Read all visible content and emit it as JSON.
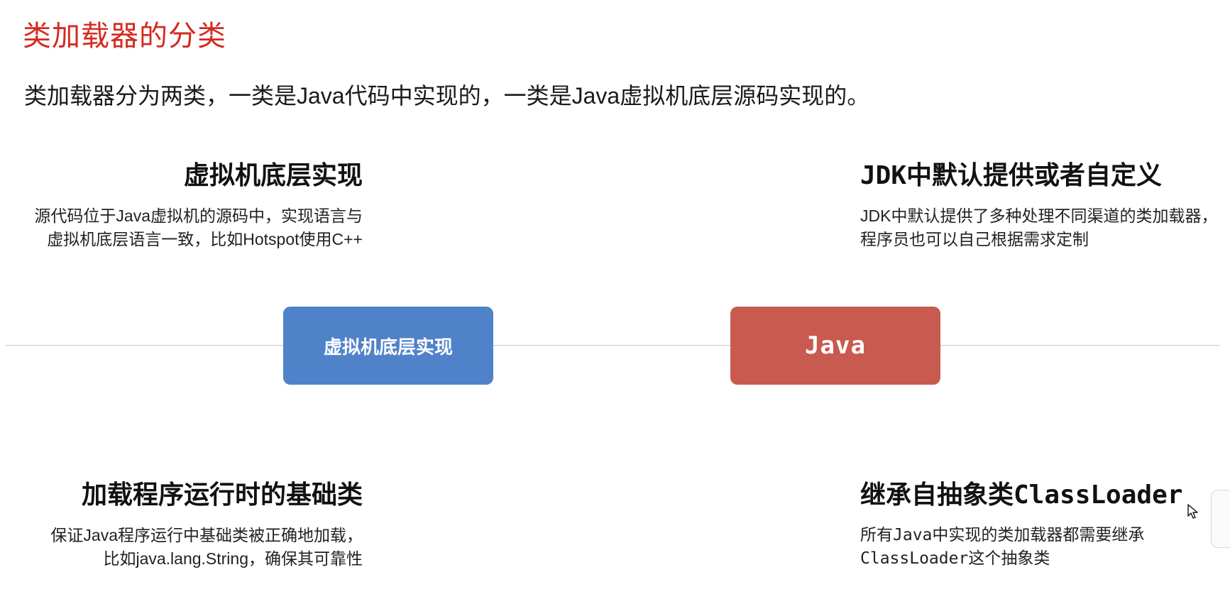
{
  "title": "类加载器的分类",
  "subtitle": "类加载器分为两类，一类是Java代码中实现的，一类是Java虚拟机底层源码实现的。",
  "diagram": {
    "nodes": {
      "left": {
        "label": "虚拟机底层实现",
        "color": "#4f82c9"
      },
      "right": {
        "label": "Java",
        "color": "#c95a50"
      }
    },
    "blocks": {
      "top_left": {
        "heading": "虚拟机底层实现",
        "lines": [
          "源代码位于Java虚拟机的源码中，实现语言与",
          "虚拟机底层语言一致，比如Hotspot使用C++"
        ]
      },
      "bottom_left": {
        "heading": "加载程序运行时的基础类",
        "lines": [
          "保证Java程序运行中基础类被正确地加载，",
          "比如java.lang.String，确保其可靠性"
        ]
      },
      "top_right": {
        "heading": "JDK中默认提供或者自定义",
        "lines": [
          "JDK中默认提供了多种处理不同渠道的类加载器，",
          "程序员也可以自己根据需求定制"
        ]
      },
      "bottom_right": {
        "heading": "继承自抽象类ClassLoader",
        "lines": [
          "所有Java中实现的类加载器都需要继承",
          "ClassLoader这个抽象类"
        ]
      }
    }
  },
  "colors": {
    "title": "#d42a1f",
    "timeline": "#c8c8c8"
  },
  "icons": {
    "cursor": "mouse-pointer-icon"
  }
}
